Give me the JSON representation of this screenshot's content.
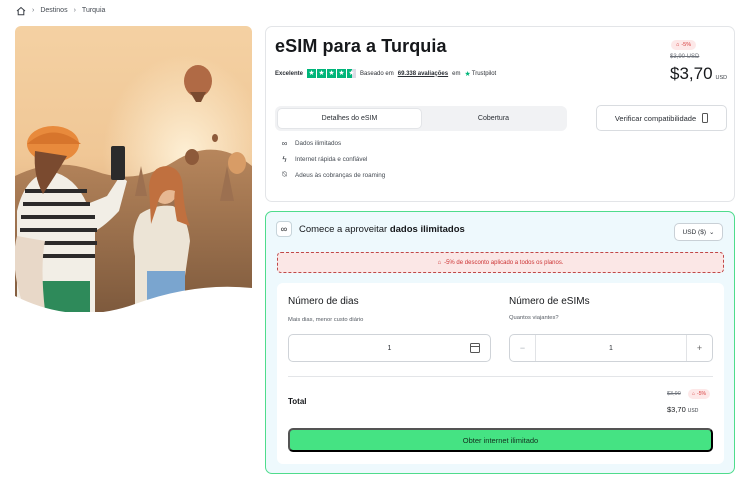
{
  "breadcrumb": {
    "items": [
      "Destinos",
      "Turquia"
    ]
  },
  "product": {
    "title": "eSIM para a Turquia",
    "rating": {
      "label": "Excelente",
      "based_on": "Baseado em",
      "reviews": "69.338 avaliações",
      "on": "em",
      "platform": "Trustpilot",
      "stars": 4.5
    },
    "discount_badge": "-5%",
    "old_price": "$3,90 USD",
    "price": "$3,70",
    "currency": "USD",
    "tabs": [
      {
        "label": "Detalhes do eSIM",
        "active": true
      },
      {
        "label": "Cobertura",
        "active": false
      }
    ],
    "verify_button": "Verificar compatibilidade",
    "features": [
      {
        "icon": "infinity-icon",
        "text": "Dados ilimitados"
      },
      {
        "icon": "lightning-icon",
        "text": "Internet rápida e confiável"
      },
      {
        "icon": "no-roaming-icon",
        "text": "Adeus às cobranças de roaming"
      }
    ]
  },
  "plan": {
    "heading_prefix": "Comece a aproveitar",
    "heading_bold": "dados ilimitados",
    "currency_select": "USD ($)",
    "discount_banner": "-5% de desconto aplicado a todos os planos.",
    "days": {
      "title": "Número de dias",
      "subtitle": "Mais dias, menor custo diário",
      "value": "1"
    },
    "esims": {
      "title": "Número de eSIMs",
      "subtitle": "Quantos viajantes?",
      "value": "1"
    },
    "total": {
      "label": "Total",
      "old_price": "$3,90",
      "badge": "-5%",
      "price": "$3,70",
      "currency": "USD"
    },
    "cta": "Obter internet ilimitado"
  },
  "colors": {
    "accent_green": "#45e383",
    "discount_red": "#d63c3c",
    "trustpilot_green": "#00b67a"
  }
}
